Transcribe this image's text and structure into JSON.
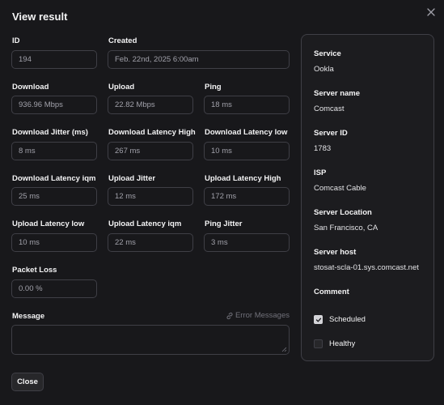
{
  "dialog": {
    "title": "View result",
    "close_label": "Close"
  },
  "fields": {
    "id": {
      "label": "ID",
      "value": "194"
    },
    "created": {
      "label": "Created",
      "value": "Feb. 22nd, 2025 6:00am"
    },
    "download": {
      "label": "Download",
      "value": "936.96 Mbps"
    },
    "upload": {
      "label": "Upload",
      "value": "22.82 Mbps"
    },
    "ping": {
      "label": "Ping",
      "value": "18 ms"
    },
    "download_jitter": {
      "label": "Download Jitter (ms)",
      "value": "8 ms"
    },
    "download_latency_high": {
      "label": "Download Latency High",
      "value": "267 ms"
    },
    "download_latency_low": {
      "label": "Download Latency low",
      "value": "10 ms"
    },
    "download_latency_iqm": {
      "label": "Download Latency iqm",
      "value": "25 ms"
    },
    "upload_jitter": {
      "label": "Upload Jitter",
      "value": "12 ms"
    },
    "upload_latency_high": {
      "label": "Upload Latency High",
      "value": "172 ms"
    },
    "upload_latency_low": {
      "label": "Upload Latency low",
      "value": "10 ms"
    },
    "upload_latency_iqm": {
      "label": "Upload Latency iqm",
      "value": "22 ms"
    },
    "ping_jitter": {
      "label": "Ping Jitter",
      "value": "3 ms"
    },
    "packet_loss": {
      "label": "Packet Loss",
      "value": "0.00 %"
    }
  },
  "message": {
    "label": "Message",
    "link_label": "Error Messages",
    "value": ""
  },
  "panel": {
    "service_label": "Service",
    "service": "Ookla",
    "server_name_label": "Server name",
    "server_name": "Comcast",
    "server_id_label": "Server ID",
    "server_id": "1783",
    "isp_label": "ISP",
    "isp": "Comcast Cable",
    "server_location_label": "Server Location",
    "server_location": "San Francisco, CA",
    "server_host_label": "Server host",
    "server_host": "stosat-scla-01.sys.comcast.net",
    "comment_label": "Comment",
    "scheduled_label": "Scheduled",
    "scheduled": true,
    "healthy_label": "Healthy",
    "healthy": false
  }
}
